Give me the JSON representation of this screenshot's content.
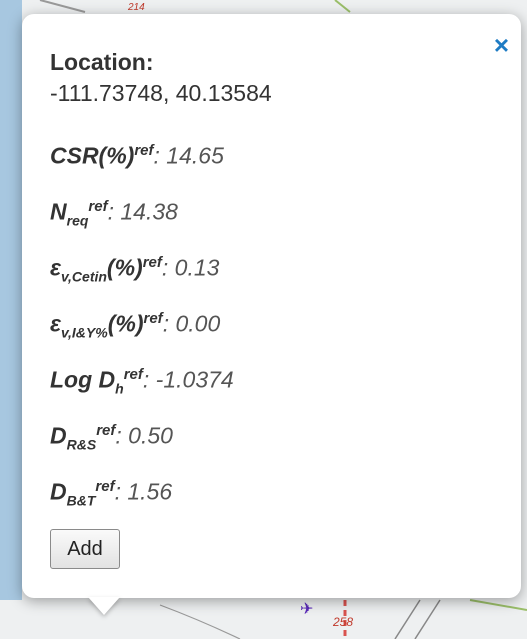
{
  "popup": {
    "location_label": "Location:",
    "location_value": "-111.73748, 40.13584",
    "close_glyph": "×",
    "sup_ref": "ref",
    "fields": {
      "csr": {
        "label": "CSR(%)",
        "value": ": 14.65"
      },
      "nreq": {
        "label": "N",
        "sub": "req",
        "value": ": 14.38"
      },
      "ev_cetin": {
        "label": "ε",
        "sub": "v,Cetin",
        "suffix": "(%)",
        "value": ": 0.13"
      },
      "ev_iy": {
        "label": "ε",
        "sub": "v,I&Y%",
        "suffix": "(%)",
        "value": ": 0.00"
      },
      "logdh": {
        "label": "Log D",
        "sub": "h",
        "value": ": -1.0374"
      },
      "drs": {
        "label": "D",
        "sub": "R&S",
        "value": ": 0.50"
      },
      "dbt": {
        "label": "D",
        "sub": "B&T",
        "value": ": 1.56"
      }
    },
    "add_label": "Add"
  },
  "map": {
    "road_label_top": "214",
    "road_label_bottom": "258",
    "accent_color": "#1f7cc4",
    "road_color": "#d9534f"
  }
}
